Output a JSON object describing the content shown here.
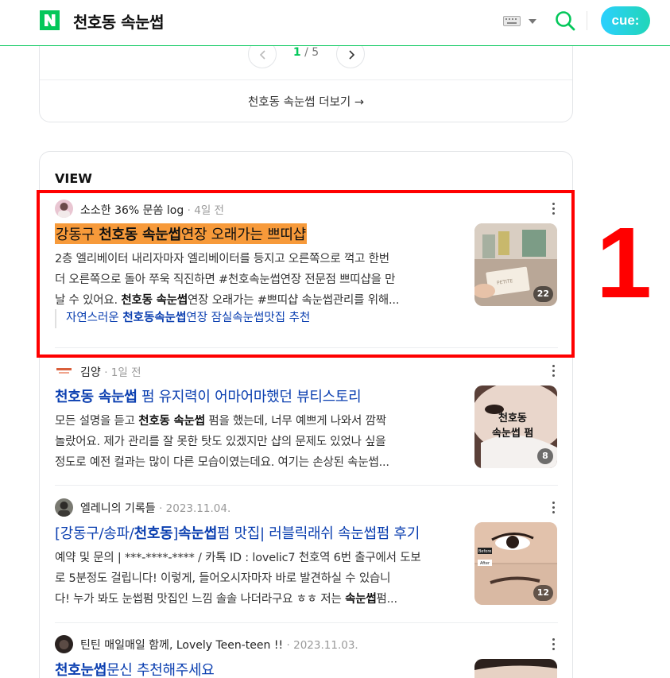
{
  "header": {
    "query": "천호동 속눈썹",
    "cue_label": "cue:",
    "icons": {
      "logo": "naver-n-logo",
      "keyboard": "keyboard-icon",
      "search": "search-icon"
    },
    "colors": {
      "brand": "#03c75a",
      "cue": "#21d6b8"
    }
  },
  "pager": {
    "current": "1",
    "total": "/ 5",
    "more_link": "천호동 속눈썹 더보기 →"
  },
  "view": {
    "title": "VIEW",
    "items": [
      {
        "author": "소소한 36% 문쏨 log",
        "time": "· 4일 전",
        "title_parts": [
          "강동구 ",
          "천호동 속눈썹",
          "연장 오래가는 쁘띠샵"
        ],
        "desc_line1": "2층 엘리베이터 내리자마자 엘리베이터를 등지고 오른쪽으로 꺽고 한번",
        "desc_line2": "더 오른쪽으로 돌아 쭈욱 직진하면 #천호속눈썹연장 전문점 쁘띠샵을 만",
        "desc_line3_pre": "날 수 있어요. ",
        "desc_line3_bold": "천호동 속눈썹",
        "desc_line3_post": "연장 오래가는 #쁘띠샵 속눈썹관리를 위해...",
        "image_count": "22",
        "thumb_text": "PETITE",
        "sub_pre": "자연스러운 ",
        "sub_bold": "천호동속눈썹",
        "sub_post": "연장 잠실속눈썹맛집 추천"
      },
      {
        "author": "김양",
        "time": "· 1일 전",
        "title_bold": "천호동 속눈썹",
        "title_post": " 펌 유지력이 어마어마했던 뷰티스토리",
        "desc_line1_pre": "모든 설명을 듣고 ",
        "desc_line1_bold": "천호동 속눈썹",
        "desc_line1_post": " 펌을 했는데, 너무 예쁘게 나와서 깜짝",
        "desc_line2": "놀랐어요. 제가 관리를 잘 못한 탓도 있겠지만 샵의 문제도 있었나 싶을",
        "desc_line3": "정도로 예전 컬과는 많이 다른 모습이였는데요. 여기는 손상된 속눈썹...",
        "image_count": "8",
        "thumb_text_1": "천호동",
        "thumb_text_2": "속눈썹 펌"
      },
      {
        "author": "엘레니의 기록들",
        "time": "· 2023.11.04.",
        "title_pre": "[강동구/송파/",
        "title_bold1": "천호동",
        "title_mid": "]",
        "title_bold2": "속눈썹",
        "title_post": "펌 맛집| 러블릭래쉬 속눈썹펌 후기",
        "desc_line1": "예약 및 문의 | ***-****-**** / 카톡 ID : lovelic7 천호역 6번 출구에서 도보",
        "desc_line2": "로 5분정도 걸립니다! 이렇게, 들어오시자마자 바로 발견하실 수 있습니",
        "desc_line3_pre": "다! 누가 봐도 눈썹펌 맛집인 느낌 솔솔 나더라구요 ㅎㅎ 저는 ",
        "desc_line3_bold": "속눈썹",
        "desc_line3_post": "펌...",
        "image_count": "12",
        "thumb_before": "Before",
        "thumb_after": "After"
      },
      {
        "author": "틴틴 매일매일 함께, Lovely Teen-teen !!",
        "time": "· 2023.11.03.",
        "title_bold": "천호눈썹",
        "title_post": "문신 추천해주세요"
      }
    ]
  },
  "annotation": {
    "label": "1",
    "color": "#ff0000"
  }
}
